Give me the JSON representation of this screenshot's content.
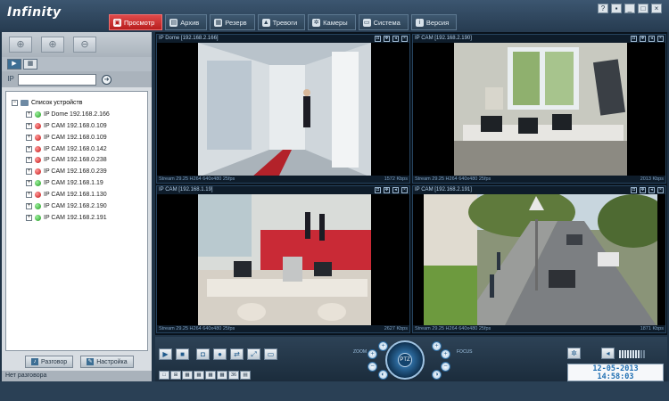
{
  "app": {
    "title": "Infinity"
  },
  "colors": {
    "accent": "#d42a2a",
    "panel": "#d8dde2",
    "frame": "#1f3346",
    "clock": "#1f6fb2"
  },
  "tabs": [
    {
      "label": "Просмотр",
      "icon": "display-icon",
      "active": true
    },
    {
      "label": "Архив",
      "icon": "archive-icon",
      "active": false
    },
    {
      "label": "Резерв",
      "icon": "backup-icon",
      "active": false
    },
    {
      "label": "Тревоги",
      "icon": "alarm-icon",
      "active": false
    },
    {
      "label": "Камеры",
      "icon": "gear-icon",
      "active": false
    },
    {
      "label": "Система",
      "icon": "monitor-icon",
      "active": false
    },
    {
      "label": "Версия",
      "icon": "info-icon",
      "active": false
    }
  ],
  "window_controls": [
    "help-icon",
    "lock-icon",
    "minimize-icon",
    "maximize-icon",
    "close-icon"
  ],
  "device_panel": {
    "search_value": "",
    "root_label": "Список устройств",
    "devices": [
      {
        "label": "IP Dome 192.168.2.166",
        "status": "green"
      },
      {
        "label": "IP CAM 192.168.0.109",
        "status": "red"
      },
      {
        "label": "IP CAM 192.168.0.109",
        "status": "red"
      },
      {
        "label": "IP CAM 192.168.0.142",
        "status": "red"
      },
      {
        "label": "IP CAM 192.168.0.238",
        "status": "red"
      },
      {
        "label": "IP CAM 192.168.0.239",
        "status": "red"
      },
      {
        "label": "IP CAM 192.168.1.19",
        "status": "green"
      },
      {
        "label": "IP CAM 192.168.1.130",
        "status": "red"
      },
      {
        "label": "IP CAM 192.168.2.190",
        "status": "green"
      },
      {
        "label": "IP CAM 192.168.2.191",
        "status": "green"
      }
    ],
    "talk_button": "Разговор",
    "settings_button": "Настройка",
    "status_text": "Нет разговора"
  },
  "cameras": [
    {
      "title": "IP Dome [192.168.2.166]",
      "stream": "Stream 29.25 H264 640x480 25fps",
      "bitrate": "1572 Kbps"
    },
    {
      "title": "IP CAM [192.168.2.190]",
      "stream": "Stream 29.25 H264 640x480 25fps",
      "bitrate": "2013 Kbps"
    },
    {
      "title": "IP CAM [192.168.1.19]",
      "stream": "Stream 29.25 H264 640x480 25fps",
      "bitrate": "2627 Kbps"
    },
    {
      "title": "IP CAM [192.168.2.191]",
      "stream": "Stream 29.25 H264 640x480 25fps",
      "bitrate": "1871 Kbps"
    }
  ],
  "controls": {
    "ptz_label": "PTZ",
    "zoom_label": "ZOOM",
    "focus_label": "FOCUS",
    "layout_count": "36",
    "volume_level": 0.8,
    "date": "12-05-2013",
    "time": "14:58:03"
  }
}
